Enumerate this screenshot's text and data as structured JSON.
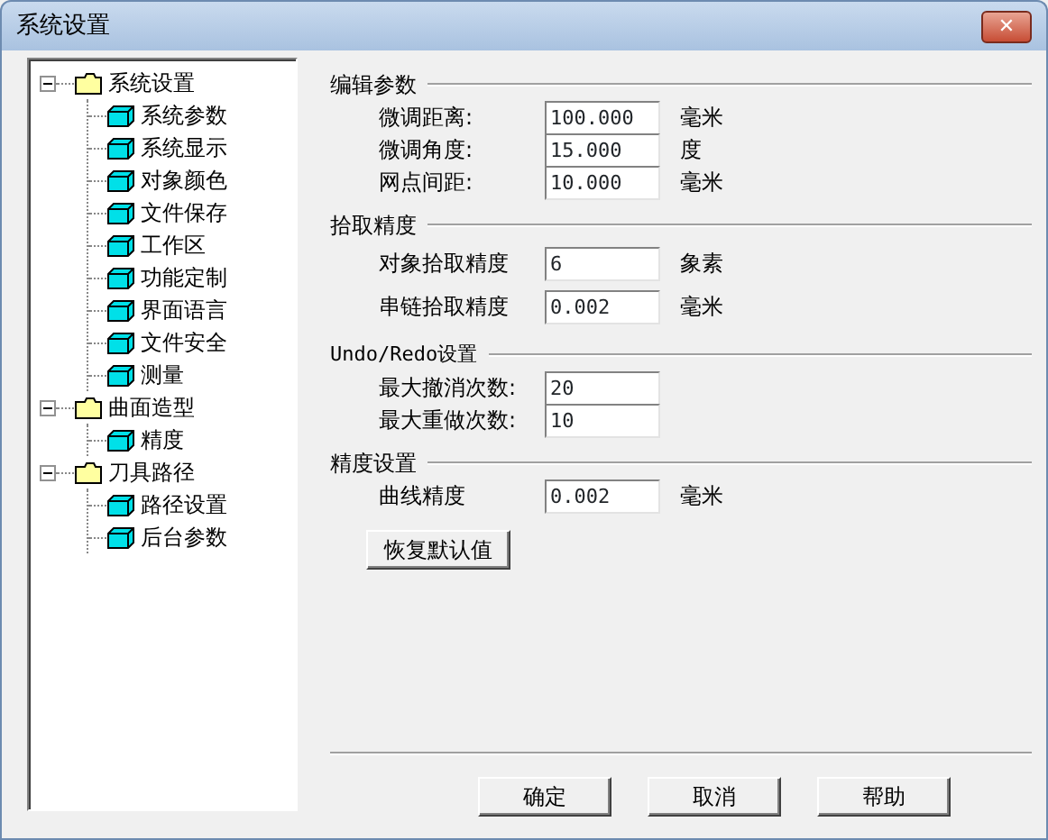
{
  "window": {
    "title": "系统设置",
    "close": "✕"
  },
  "tree": [
    {
      "label": "系统设置",
      "expanded": true,
      "children": [
        {
          "label": "系统参数"
        },
        {
          "label": "系统显示"
        },
        {
          "label": "对象颜色"
        },
        {
          "label": "文件保存"
        },
        {
          "label": "工作区"
        },
        {
          "label": "功能定制"
        },
        {
          "label": "界面语言"
        },
        {
          "label": "文件安全"
        },
        {
          "label": "测量"
        }
      ]
    },
    {
      "label": "曲面造型",
      "expanded": true,
      "children": [
        {
          "label": "精度"
        }
      ]
    },
    {
      "label": "刀具路径",
      "expanded": true,
      "children": [
        {
          "label": "路径设置"
        },
        {
          "label": "后台参数"
        }
      ]
    }
  ],
  "sections": [
    {
      "title": "编辑参数",
      "rows": [
        {
          "label": "微调距离:",
          "value": "100.000",
          "unit": "毫米"
        },
        {
          "label": "微调角度:",
          "value": "15.000",
          "unit": "度"
        },
        {
          "label": "网点间距:",
          "value": "10.000",
          "unit": "毫米"
        }
      ]
    },
    {
      "title": "拾取精度",
      "rows": [
        {
          "label": "对象拾取精度",
          "value": "6",
          "unit": "象素"
        },
        {
          "label": "串链拾取精度",
          "value": "0.002",
          "unit": "毫米"
        }
      ]
    },
    {
      "title": "Undo/Redo设置",
      "rows": [
        {
          "label": "最大撤消次数:",
          "value": "20"
        },
        {
          "label": "最大重做次数:",
          "value": "10"
        }
      ]
    },
    {
      "title": "精度设置",
      "rows": [
        {
          "label": "曲线精度",
          "value": "0.002",
          "unit": "毫米"
        }
      ]
    }
  ],
  "restore_button": "恢复默认值",
  "buttons": [
    "确定",
    "取消",
    "帮助"
  ]
}
